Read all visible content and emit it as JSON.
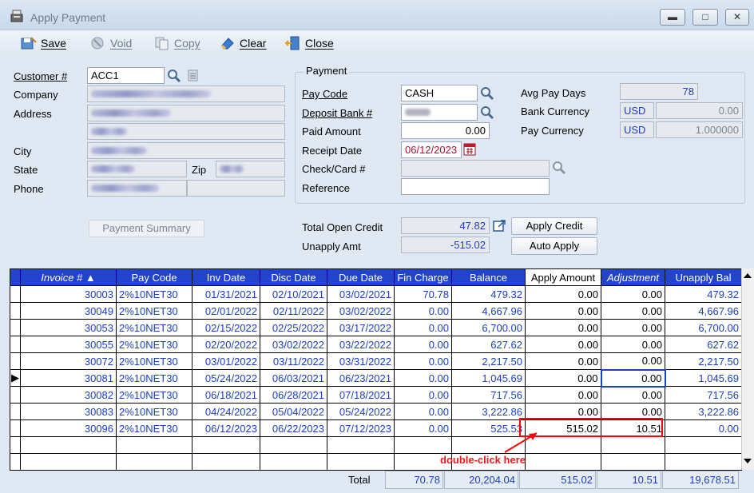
{
  "window": {
    "title": "Apply Payment"
  },
  "toolbar": {
    "save": "Save",
    "void": "Void",
    "copy": "Copy",
    "clear": "Clear",
    "close": "Close"
  },
  "customer": {
    "customer_label": "Customer #",
    "customer_value": "ACC1",
    "company_label": "Company",
    "address_label": "Address",
    "city_label": "City",
    "state_label": "State",
    "zip_label": "Zip",
    "phone_label": "Phone"
  },
  "payment_summary_button": "Payment Summary",
  "payment": {
    "group_title": "Payment",
    "pay_code_label": "Pay Code",
    "pay_code_value": "CASH",
    "deposit_bank_label": "Deposit Bank #",
    "paid_amount_label": "Paid Amount",
    "paid_amount_value": "0.00",
    "receipt_date_label": "Receipt Date",
    "receipt_date_value": "06/12/2023",
    "check_card_label": "Check/Card #",
    "reference_label": "Reference",
    "avg_pay_days_label": "Avg Pay Days",
    "avg_pay_days_value": "78",
    "bank_currency_label": "Bank Currency",
    "bank_currency_code": "USD",
    "bank_currency_value": "0.00",
    "pay_currency_label": "Pay Currency",
    "pay_currency_code": "USD",
    "pay_currency_value": "1.000000"
  },
  "credit": {
    "total_open_credit_label": "Total Open Credit",
    "total_open_credit_value": "47.82",
    "unapply_amt_label": "Unapply Amt",
    "unapply_amt_value": "-515.02",
    "apply_credit_button": "Apply Credit",
    "auto_apply_button": "Auto Apply"
  },
  "grid": {
    "columns": [
      "Invoice # ▲",
      "Pay Code",
      "Inv Date",
      "Disc Date",
      "Due Date",
      "Fin Charge",
      "Balance",
      "Apply Amount",
      "Adjustment",
      "Unapply Bal"
    ],
    "rows": [
      [
        "30003",
        "2%10NET30",
        "01/31/2021",
        "02/10/2021",
        "03/02/2021",
        "70.78",
        "479.32",
        "0.00",
        "0.00",
        "479.32"
      ],
      [
        "30049",
        "2%10NET30",
        "02/01/2022",
        "02/11/2022",
        "03/02/2022",
        "0.00",
        "4,667.96",
        "0.00",
        "0.00",
        "4,667.96"
      ],
      [
        "30053",
        "2%10NET30",
        "02/15/2022",
        "02/25/2022",
        "03/17/2022",
        "0.00",
        "6,700.00",
        "0.00",
        "0.00",
        "6,700.00"
      ],
      [
        "30055",
        "2%10NET30",
        "02/20/2022",
        "03/02/2022",
        "03/22/2022",
        "0.00",
        "627.62",
        "0.00",
        "0.00",
        "627.62"
      ],
      [
        "30072",
        "2%10NET30",
        "03/01/2022",
        "03/11/2022",
        "03/31/2022",
        "0.00",
        "2,217.50",
        "0.00",
        "0.00",
        "2,217.50"
      ],
      [
        "30081",
        "2%10NET30",
        "05/24/2022",
        "06/03/2021",
        "06/23/2021",
        "0.00",
        "1,045.69",
        "0.00",
        "0.00",
        "1,045.69"
      ],
      [
        "30082",
        "2%10NET30",
        "06/18/2021",
        "06/28/2021",
        "07/18/2021",
        "0.00",
        "717.56",
        "0.00",
        "0.00",
        "717.56"
      ],
      [
        "30083",
        "2%10NET30",
        "04/24/2022",
        "05/04/2022",
        "05/24/2022",
        "0.00",
        "3,222.86",
        "0.00",
        "0.00",
        "3,222.86"
      ],
      [
        "30096",
        "2%10NET30",
        "06/12/2023",
        "06/22/2023",
        "07/12/2023",
        "0.00",
        "525.53",
        "515.02",
        "10.51",
        "0.00"
      ]
    ]
  },
  "totals": {
    "label": "Total",
    "fin_charge": "70.78",
    "balance": "20,204.04",
    "apply_amount": "515.02",
    "adjustment": "10.51",
    "unapply_bal": "19,678.51"
  },
  "annotation": {
    "text": "double-click here",
    "color": "#ff0000"
  },
  "colors": {
    "header_blue": "#2244cc",
    "value_blue": "#1a3fbf",
    "window_bg": "#dfe8f3"
  }
}
